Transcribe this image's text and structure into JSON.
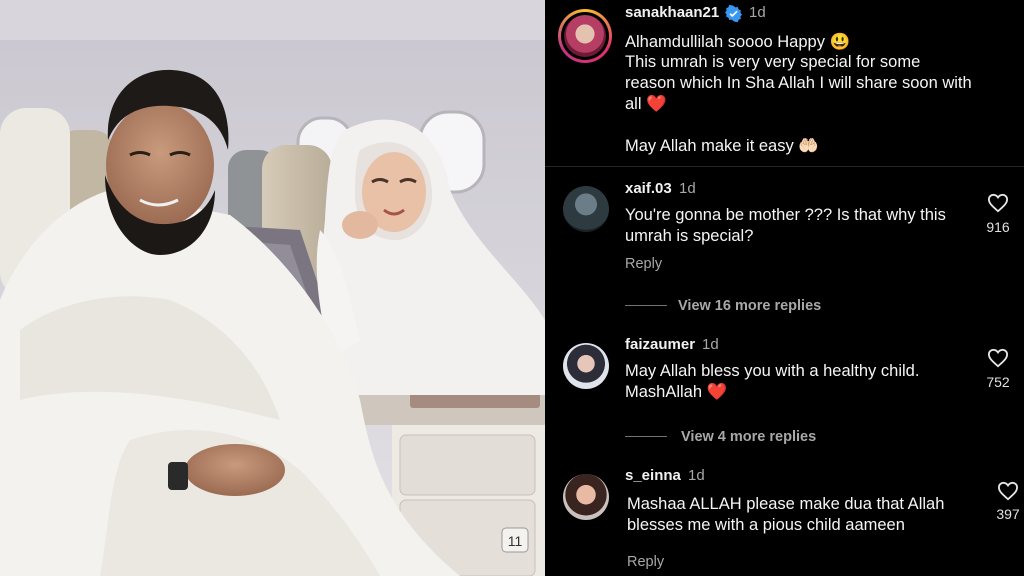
{
  "post": {
    "username": "sanakhaan21",
    "time": "1d",
    "caption_lines": [
      "Alhamdullilah soooo Happy 😃",
      "This umrah is very very special for some",
      "reason which In Sha Allah I will share soon with",
      "all ❤️",
      "May Allah make it easy 🤲🏻"
    ]
  },
  "comments": [
    {
      "username": "xaif.03",
      "time": "1d",
      "lines": [
        "You're gonna be mother ??? Is that why this",
        "umrah is special?"
      ],
      "likes": "916",
      "reply_label": "Reply",
      "more_replies": "View 16 more replies"
    },
    {
      "username": "faizaumer",
      "time": "1d",
      "lines": [
        "May Allah bless you with a healthy child.",
        "MashAllah ❤️"
      ],
      "likes": "752",
      "more_replies": "View 4 more replies"
    },
    {
      "username": "s_einna",
      "time": "1d",
      "lines": [
        "Mashaa ALLAH please make dua that Allah",
        "blesses me with a pious child aameen"
      ],
      "likes": "397",
      "reply_label": "Reply"
    }
  ],
  "icons": {
    "verified": "verified-badge-icon",
    "like": "heart-outline-icon"
  },
  "colors": {
    "background": "#000000",
    "verified_blue": "#3897f0",
    "heart_red": "#ed1c2e",
    "secondary_text": "#a8a8a8"
  }
}
